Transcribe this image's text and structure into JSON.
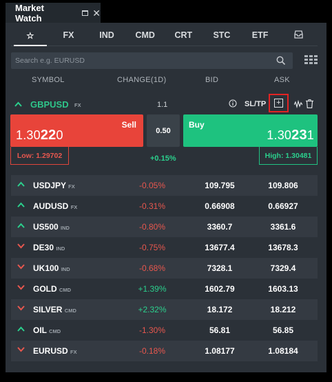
{
  "window": {
    "title": "Market Watch",
    "icons": [
      "maximize-icon",
      "close-icon"
    ]
  },
  "tabs": [
    {
      "label": "☆",
      "icon": "star-icon",
      "active": true
    },
    {
      "label": "FX"
    },
    {
      "label": "IND"
    },
    {
      "label": "CMD"
    },
    {
      "label": "CRT"
    },
    {
      "label": "STC"
    },
    {
      "label": "ETF"
    },
    {
      "label": "",
      "icon": "inbox-icon"
    }
  ],
  "search": {
    "placeholder": "Search e.g. EURUSD",
    "value": ""
  },
  "columns": {
    "symbol": "SYMBOL",
    "change": "CHANGE(1D)",
    "bid": "BID",
    "ask": "ASK"
  },
  "expanded": {
    "symbol": "GBPUSD",
    "class": "FX",
    "spread": "1.1",
    "sltp": "SL/TP",
    "sell": {
      "label": "Sell",
      "price_start": "1.30",
      "price_big": "22",
      "price_end": "0"
    },
    "buy": {
      "label": "Buy",
      "price_start": "1.30",
      "price_big": "23",
      "price_end": "1"
    },
    "spread_box": "0.50",
    "change": "+0.15%",
    "low": "Low: 1.29702",
    "high": "High: 1.30481"
  },
  "rows": [
    {
      "symbol": "USDJPY",
      "class": "FX",
      "dir": "up",
      "change": "-0.05%",
      "bid": "109.795",
      "ask": "109.806"
    },
    {
      "symbol": "AUDUSD",
      "class": "FX",
      "dir": "up",
      "change": "-0.31%",
      "bid": "0.66908",
      "ask": "0.66927"
    },
    {
      "symbol": "US500",
      "class": "IND",
      "dir": "up",
      "change": "-0.80%",
      "bid": "3360.7",
      "ask": "3361.6"
    },
    {
      "symbol": "DE30",
      "class": "IND",
      "dir": "down",
      "change": "-0.75%",
      "bid": "13677.4",
      "ask": "13678.3"
    },
    {
      "symbol": "UK100",
      "class": "IND",
      "dir": "down",
      "change": "-0.68%",
      "bid": "7328.1",
      "ask": "7329.4"
    },
    {
      "symbol": "GOLD",
      "class": "CMD",
      "dir": "down",
      "change": "+1.39%",
      "bid": "1602.79",
      "ask": "1603.13"
    },
    {
      "symbol": "SILVER",
      "class": "CMD",
      "dir": "down",
      "change": "+2.32%",
      "bid": "18.172",
      "ask": "18.212"
    },
    {
      "symbol": "OIL",
      "class": "CMD",
      "dir": "up",
      "change": "-1.30%",
      "bid": "56.81",
      "ask": "56.85"
    },
    {
      "symbol": "EURUSD",
      "class": "FX",
      "dir": "down",
      "change": "-0.18%",
      "bid": "1.08177",
      "ask": "1.08184"
    }
  ],
  "colors": {
    "up": "#2bd08d",
    "down": "#e8574e",
    "sell": "#e8443a",
    "buy": "#1ec27f",
    "highlight": "#e32323"
  }
}
